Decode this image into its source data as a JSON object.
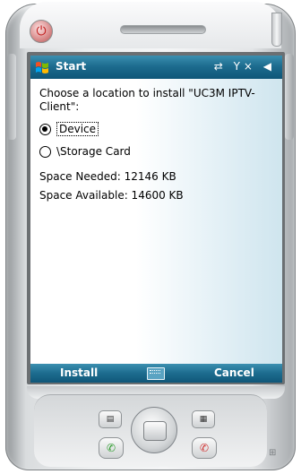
{
  "titlebar": {
    "title": "Start",
    "status_icons": [
      "connectivity-icon",
      "signal-off-icon",
      "volume-icon"
    ],
    "status_glyphs": "⇄ Y× ◀"
  },
  "install": {
    "prompt": "Choose a location to install \"UC3M IPTV-Client\":",
    "options": [
      {
        "label": "Device",
        "selected": true
      },
      {
        "label": "\\Storage Card",
        "selected": false
      }
    ],
    "space_needed": "Space Needed:  12146 KB",
    "space_available": "Space Available: 14600 KB"
  },
  "softkeys": {
    "left": "Install",
    "right": "Cancel"
  },
  "colors": {
    "titlebar": "#1d6c8f",
    "softbar": "#1d6c8f",
    "content_gradient_end": "#cfe5ee"
  }
}
